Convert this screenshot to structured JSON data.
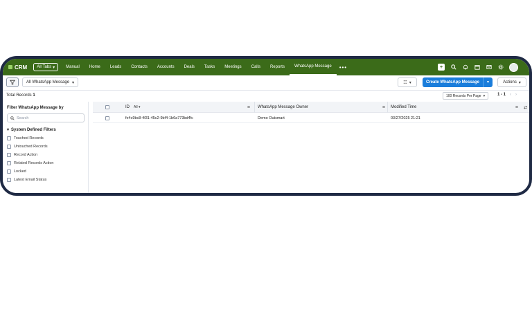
{
  "app": {
    "brand": "CRM",
    "all_tabs_label": "All Tabs",
    "nav": [
      {
        "label": "Manual"
      },
      {
        "label": "Home"
      },
      {
        "label": "Leads"
      },
      {
        "label": "Contacts"
      },
      {
        "label": "Accounts"
      },
      {
        "label": "Deals"
      },
      {
        "label": "Tasks"
      },
      {
        "label": "Meetings"
      },
      {
        "label": "Calls"
      },
      {
        "label": "Reports"
      },
      {
        "label": "WhatsApp Message",
        "active": true
      }
    ],
    "nav_more": "•••",
    "topbar_color": "#3b6b19",
    "top_icons": [
      "plus-icon",
      "search-icon",
      "bell-icon",
      "calendar-icon",
      "mail-icon",
      "gear-icon",
      "avatar"
    ]
  },
  "toolbar": {
    "view_select": "All WhatsApp Message",
    "create_button": "Create WhatsApp Message",
    "actions_button": "Actions",
    "accent": "#1a7ddb"
  },
  "subbar": {
    "total_label": "Total Records",
    "total_count": "1",
    "per_page": "100 Records Per Page",
    "range": "1 - 1"
  },
  "sidebar": {
    "title": "Filter WhatsApp Message by",
    "search_placeholder": "Search",
    "section": "System Defined Filters",
    "filters": [
      "Touched Records",
      "Untouched Records",
      "Record Action",
      "Related Records Action",
      "Locked",
      "Latest Email Status"
    ]
  },
  "table": {
    "columns": {
      "id": "ID",
      "id_filter": "All",
      "owner": "WhatsApp Message Owner",
      "modified": "Modified Time"
    },
    "rows": [
      {
        "id": "fe4c9bc8-4f31-45c2-9bf4-1b6a773bd4fc",
        "owner": "Demo Outsmart",
        "modified": "03/27/2025 21:21"
      }
    ]
  }
}
